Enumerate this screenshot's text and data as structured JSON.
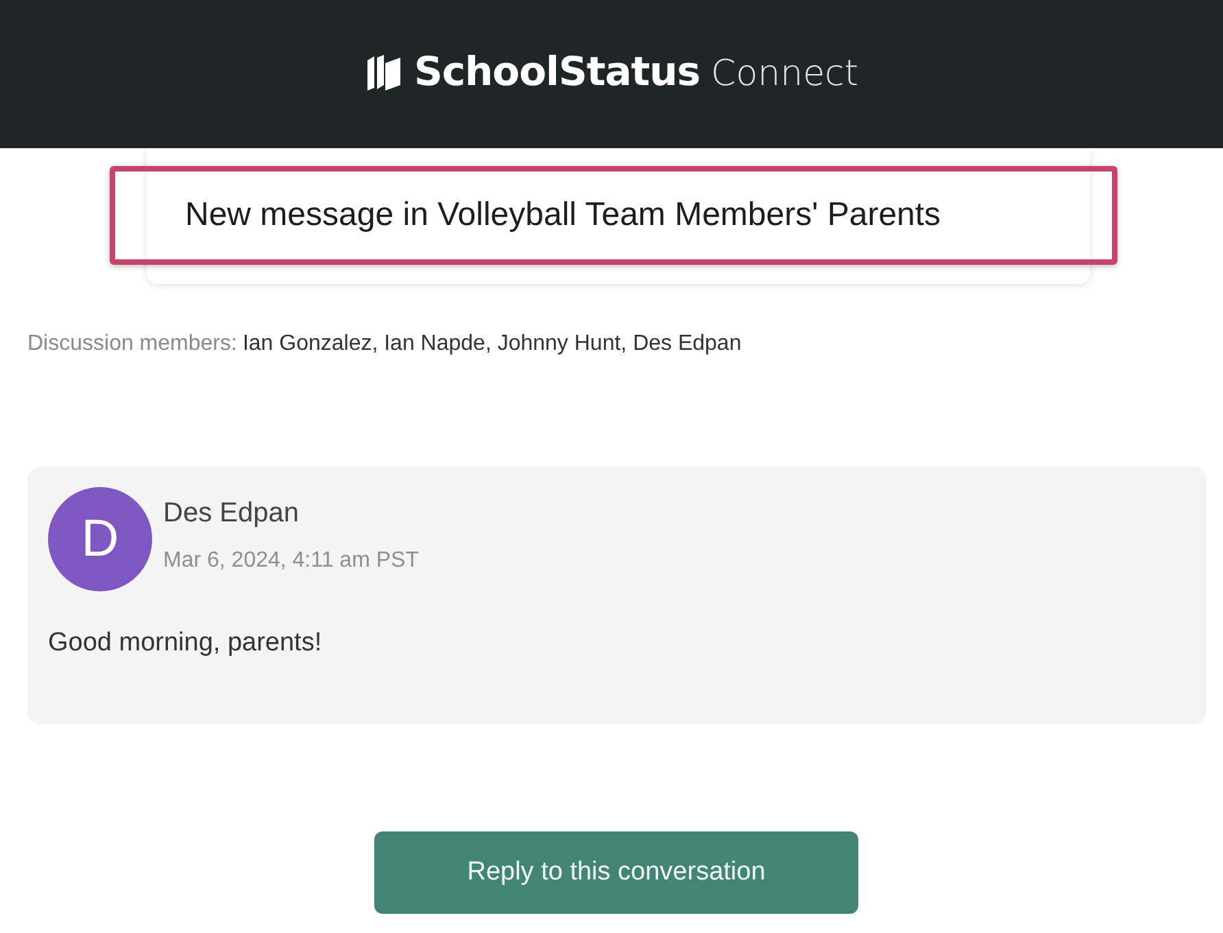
{
  "header": {
    "brand": "SchoolStatus",
    "product": "Connect"
  },
  "notice": {
    "title": "New message in Volleyball Team Members' Parents",
    "highlighted": true
  },
  "members": {
    "label": "Discussion members:",
    "names": "Ian Gonzalez, Ian Napde, Johnny Hunt, Des Edpan"
  },
  "message": {
    "avatar_letter": "D",
    "author": "Des Edpan",
    "time": "Mar 6, 2024, 4:11 am PST",
    "body": "Good morning, parents!"
  },
  "reply_button": {
    "label": "Reply to this conversation"
  }
}
